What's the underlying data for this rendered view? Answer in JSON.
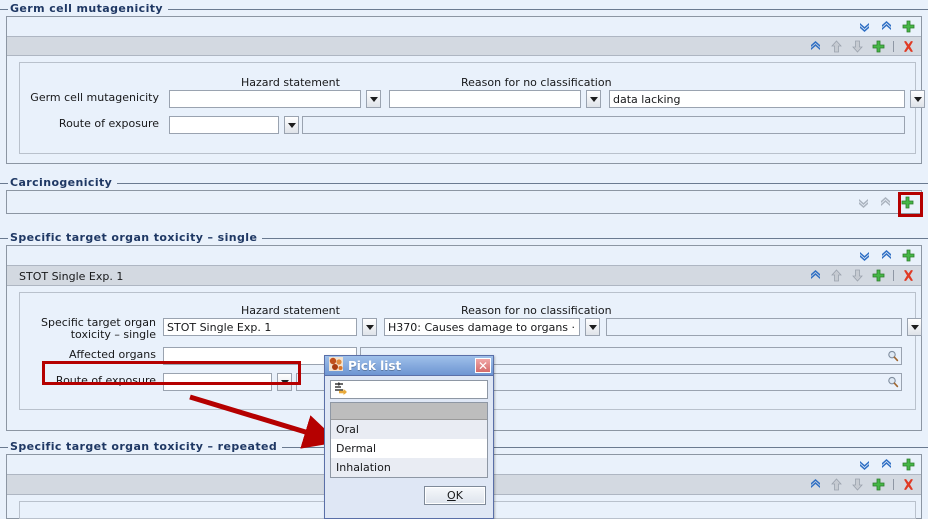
{
  "colors": {
    "panel_bg": "#e9f1fb",
    "toolbar_bg": "#d3d9e1",
    "legend_text": "#1f3864",
    "highlight_red": "#b50000",
    "dialog_title": "#6d95d2"
  },
  "sections": [
    {
      "legend": "Germ cell mutagenicity",
      "record_label": "",
      "fields": {
        "col1_header": "",
        "col2_header": "Hazard statement",
        "col3_header": "Reason for no classification",
        "row1_label": "Germ cell mutagenicity",
        "row1_value": "",
        "row1_hazard": "",
        "row1_reason": "data lacking",
        "row2_label": "Route of exposure",
        "row2_value": "",
        "row2_extra": ""
      }
    },
    {
      "legend": "Carcinogenicity"
    },
    {
      "legend": "Specific target organ toxicity – single",
      "record_label": "STOT Single Exp. 1",
      "fields": {
        "col2_header": "Hazard statement",
        "col3_header": "Reason for no classification",
        "row1_label": "Specific target organ toxicity – single",
        "row1_value": "STOT Single Exp. 1",
        "row1_hazard": "H370: Causes damage to organs ·",
        "row1_reason": "",
        "row2_label": "Affected organs",
        "row2_value": "",
        "row3_label": "Route of exposure",
        "row3_value": ""
      }
    },
    {
      "legend": "Specific target organ toxicity – repeated"
    }
  ],
  "toolbar_icons": {
    "expand_all": "double-chevron-down-icon",
    "collapse_all": "double-chevron-up-icon",
    "add": "plus-icon",
    "collapse": "double-chevron-up-icon",
    "move_up": "arrow-up-icon",
    "move_down": "arrow-down-icon",
    "delete": "red-x-icon",
    "lookup": "magnifier-icon",
    "dropdown": "chevron-down-icon"
  },
  "dialog": {
    "title": "Pick list",
    "title_icon": "pick-list-icon",
    "close_label": "✕",
    "filter_icon": "filter-icon",
    "filter_value": "",
    "items": [
      {
        "label": "Oral"
      },
      {
        "label": "Dermal"
      },
      {
        "label": "Inhalation"
      }
    ],
    "ok_label_pre": "",
    "ok_label_key": "O",
    "ok_label_post": "K"
  },
  "annotations": {
    "carcinogenicity_add_highlight": true,
    "affected_organs_highlight": true,
    "arrow_from_route_to_picklist": true
  }
}
